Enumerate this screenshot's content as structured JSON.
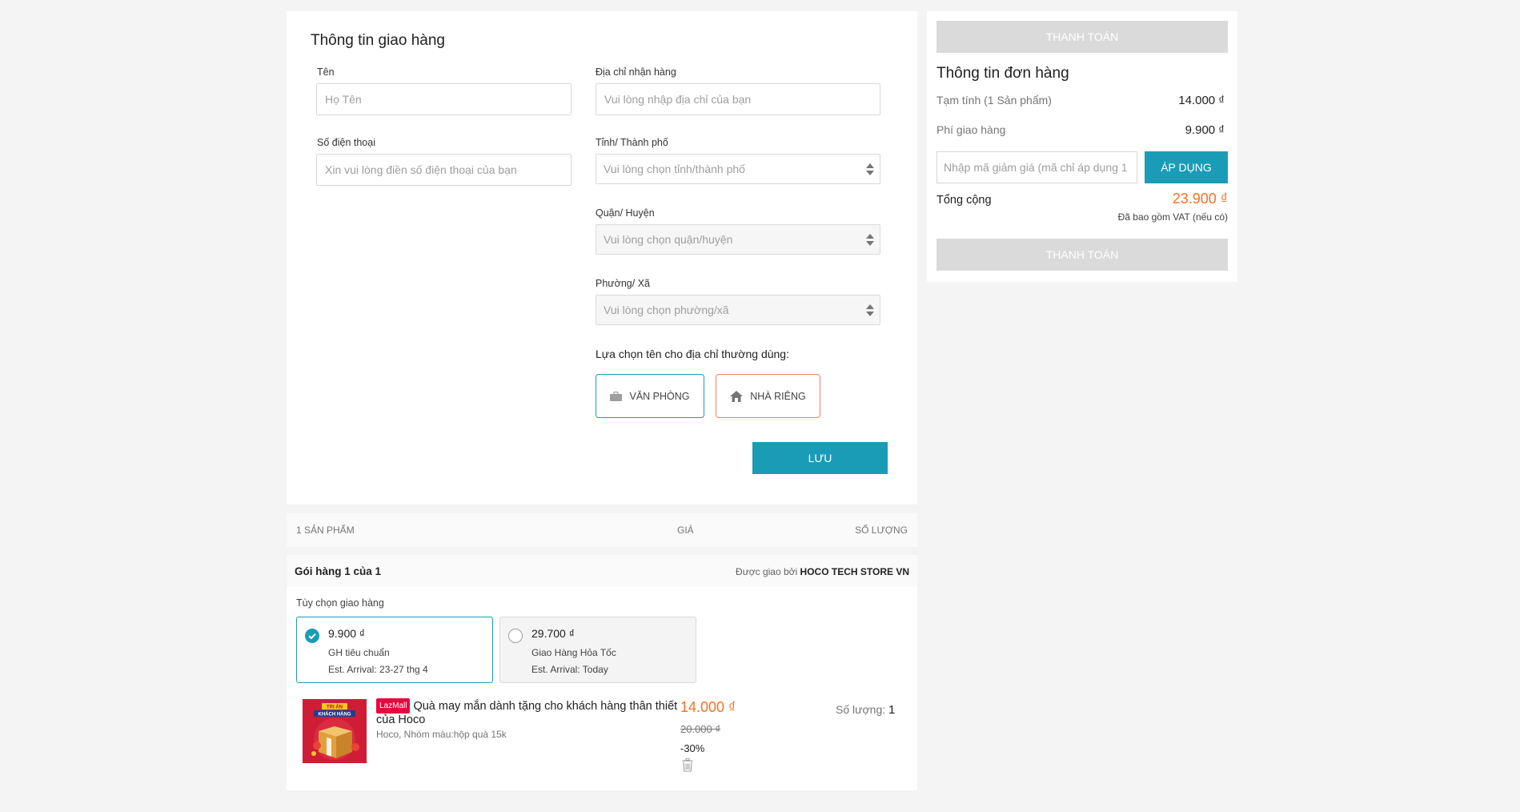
{
  "shipping": {
    "title": "Thông tin giao hàng",
    "name_label": "Tên",
    "name_placeholder": "Họ Tên",
    "phone_label": "Số điện thoại",
    "phone_placeholder": "Xin vui lòng điền số điện thoại của bạn",
    "address_label": "Địa chỉ nhận hàng",
    "address_placeholder": "Vui lòng nhập địa chỉ của bạn",
    "province_label": "Tỉnh/ Thành phố",
    "province_value": "Vui lòng chọn tỉnh/thành phố",
    "district_label": "Quận/ Huyện",
    "district_value": "Vui lòng chọn quận/huyện",
    "ward_label": "Phường/ Xã",
    "ward_value": "Vui lòng chọn phường/xã",
    "address_type_label": "Lựa chọn tên cho địa chỉ thường dùng:",
    "office_label": "VĂN PHÒNG",
    "home_label": "NHÀ RIÊNG",
    "save_label": "LƯU"
  },
  "product_header": {
    "count": "1 SẢN PHẨM",
    "price": "GIÁ",
    "quantity": "SỐ LƯỢNG"
  },
  "package": {
    "title": "Gói hàng 1 của 1",
    "delivered_by_prefix": "Được giao bởi",
    "seller": "HOCO TECH STORE VN",
    "delivery_options_label": "Tùy chọn giao hàng",
    "options": [
      {
        "price": "9.900 ₫",
        "name": "GH tiêu chuẩn",
        "eta": "Est. Arrival: 23-27 thg 4"
      },
      {
        "price": "29.700 ₫",
        "name": "Giao Hàng Hỏa Tốc",
        "eta": "Est. Arrival: Today"
      }
    ]
  },
  "product": {
    "badge": "LazMall",
    "title": "Quà may mắn dành tặng cho khách hàng thân thiết của Hoco",
    "variant": "Hoco, Nhóm màu:hộp quà 15k",
    "price": "14.000 ₫",
    "original_price": "20.000 ₫",
    "discount": "-30%",
    "qty_label": "Số lượng:",
    "qty": "1",
    "image_text_top": "TRI ÂN",
    "image_text_bottom": "KHÁCH HÀNG"
  },
  "summary": {
    "pay_label": "THANH TOÁN",
    "title": "Thông tin đơn hàng",
    "subtotal_label": "Tạm tính (1 Sản phẩm)",
    "subtotal_value": "14.000 ₫",
    "shipping_fee_label": "Phí giao hàng",
    "shipping_fee_value": "9.900 ₫",
    "voucher_placeholder": "Nhập mã giảm giá (mã chỉ áp dụng 1 lần)",
    "apply_label": "ÁP DỤNG",
    "total_label": "Tổng cộng",
    "total_value": "23.900 ₫",
    "vat_note": "Đã bao gồm VAT (nếu có)"
  },
  "colors": {
    "accent": "#1a9cb7",
    "price": "#f57224",
    "home_border": "#f57c6e",
    "disabled": "#dadada"
  },
  "icons": {
    "office": "briefcase-icon",
    "home": "home-icon",
    "selected": "check-circle-icon",
    "delete": "trash-icon",
    "select": "select-arrows-icon"
  }
}
